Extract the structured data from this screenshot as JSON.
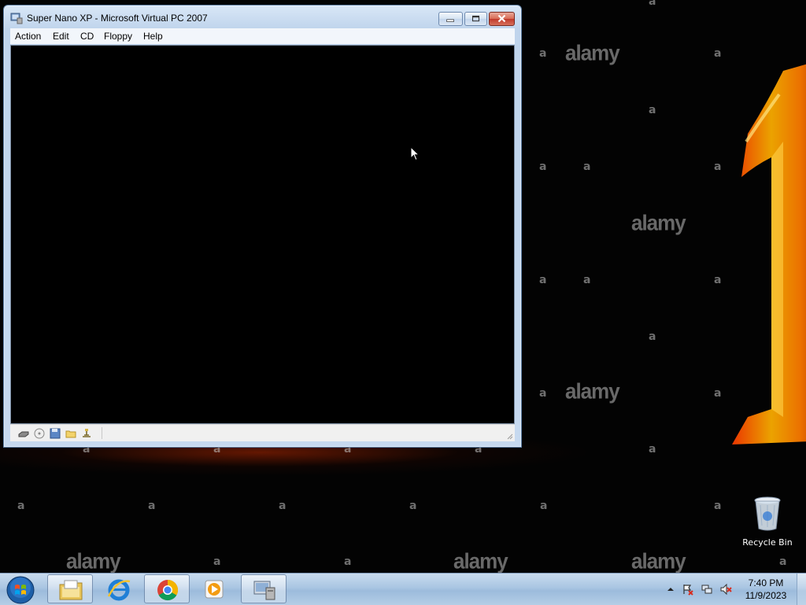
{
  "desktop": {
    "watermark_letter": "a",
    "watermark_brand": "alamy",
    "recycle_bin_label": "Recycle Bin"
  },
  "window": {
    "title": "Super Nano XP - Microsoft Virtual PC 2007",
    "menu": [
      "Action",
      "Edit",
      "CD",
      "Floppy",
      "Help"
    ],
    "status_icons": [
      "hard-disk-icon",
      "cd-drive-icon",
      "floppy-icon",
      "shared-folder-icon",
      "network-icon"
    ]
  },
  "taskbar": {
    "pinned": [
      "windows-explorer-icon",
      "internet-explorer-icon",
      "chrome-icon",
      "media-player-icon",
      "virtual-pc-icon"
    ],
    "clock": {
      "time": "7:40 PM",
      "date": "11/9/2023"
    }
  },
  "colors": {
    "taskbar": "#a9c5e2",
    "close_button": "#c0392b",
    "fire": "#ff6a00"
  }
}
